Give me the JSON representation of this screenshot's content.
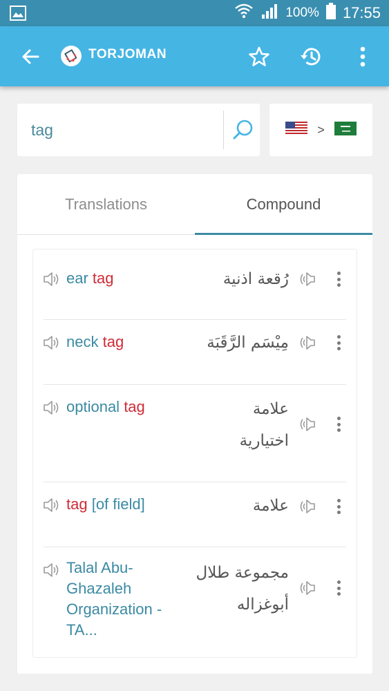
{
  "status_bar": {
    "battery": "100%",
    "time": "17:55",
    "icons": [
      "gallery-icon",
      "wifi-icon",
      "signal-icon",
      "battery-icon"
    ]
  },
  "app_bar": {
    "title": "TORJOMAN",
    "icons": [
      "back-arrow-icon",
      "torjoman-logo-icon",
      "star-icon",
      "history-icon",
      "more-vert-icon"
    ],
    "accent": "#45b5e4"
  },
  "search": {
    "value": "tag",
    "placeholder": ""
  },
  "language": {
    "from": "us-flag-icon",
    "to": "saudi-flag-icon",
    "arrow": ">"
  },
  "tabs": [
    {
      "label": "Translations"
    },
    {
      "label": "Compound"
    }
  ],
  "results": [
    {
      "en_pre": "ear ",
      "en_hl": "tag",
      "en_post": "",
      "ar": "رُقعة اذنية"
    },
    {
      "en_pre": "neck ",
      "en_hl": "tag",
      "en_post": "",
      "ar": "مِيْسَم الرَّقَبَة"
    },
    {
      "en_pre": "optional ",
      "en_hl": "tag",
      "en_post": "",
      "ar": "علامة اختيارية"
    },
    {
      "en_pre": "",
      "en_hl": "tag",
      "en_post": " [of field]",
      "ar": "علامة"
    },
    {
      "en_pre": "Talal Abu-Ghazaleh Organization - TA...",
      "en_hl": "",
      "en_post": "",
      "ar": "مجموعة طلال أبوغزاله"
    }
  ],
  "colors": {
    "status_bar": "#3a8fb0",
    "term": "#3b8aa3",
    "highlight": "#cf2b36",
    "arabic": "#555555"
  }
}
